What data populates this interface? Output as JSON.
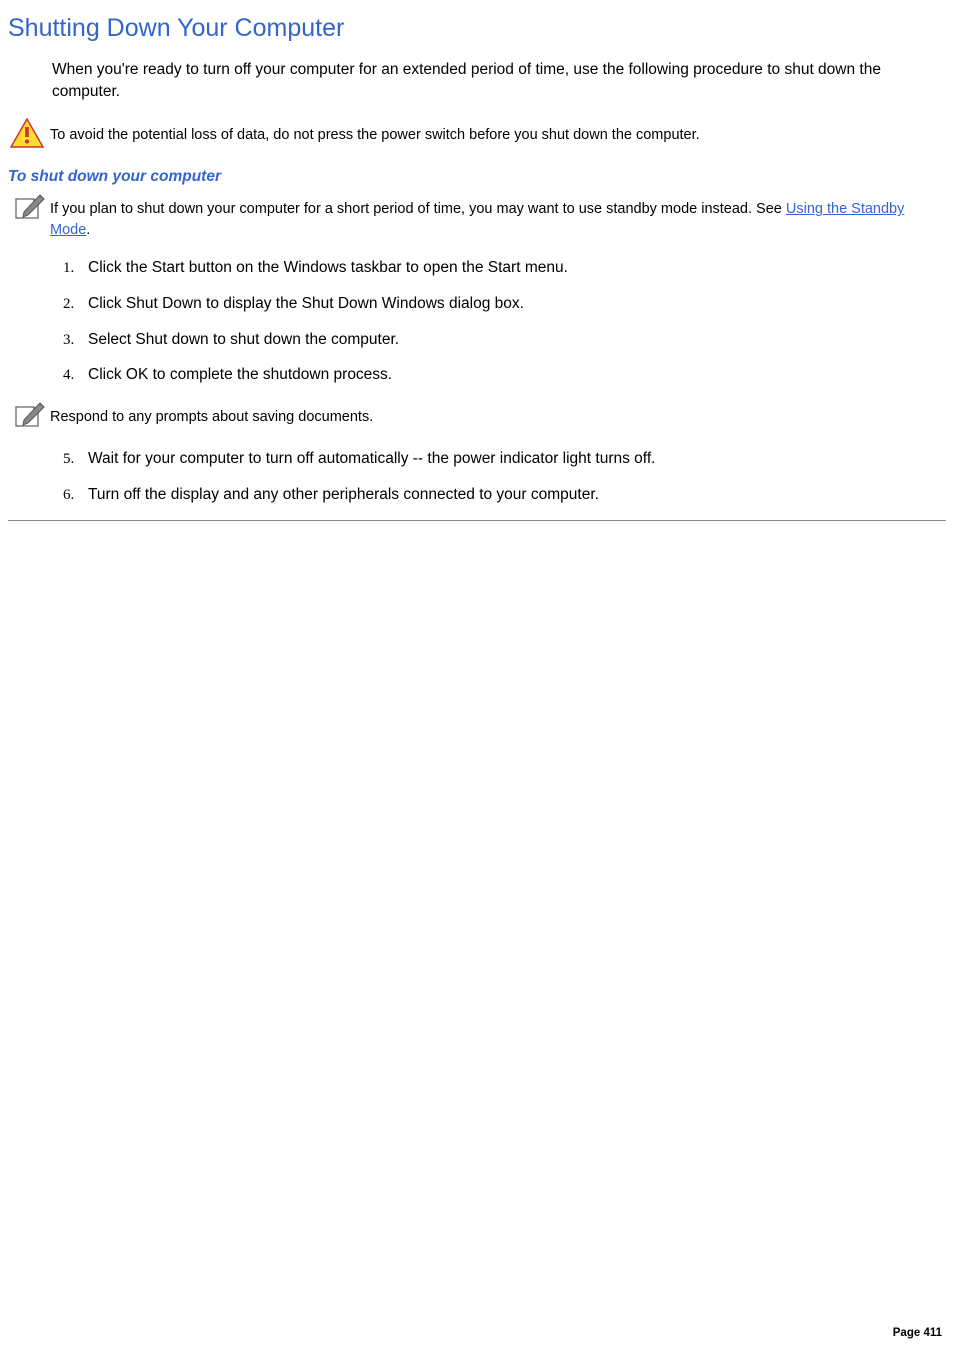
{
  "title": "Shutting Down Your Computer",
  "intro": "When you're ready to turn off your computer for an extended period of time, use the following procedure to shut down the computer.",
  "warning": "To avoid the potential loss of data, do not press the power switch before you shut down the computer.",
  "subheading": "To shut down your computer",
  "note1_before": "If you plan to shut down your computer for a short period of time, you may want to use standby mode instead. See ",
  "note1_link": "Using the Standby Mode",
  "note1_after": ".",
  "steps_a": [
    "Click the Start button on the Windows taskbar to open the Start menu.",
    "Click Shut Down to display the Shut Down Windows dialog box.",
    "Select Shut down to shut down the computer.",
    "Click OK to complete the shutdown process."
  ],
  "note2": "Respond to any prompts about saving documents.",
  "steps_b": [
    "Wait for your computer to turn off automatically -- the power indicator light turns off.",
    "Turn off the display and any other peripherals connected to your computer."
  ],
  "page_label": "Page 411"
}
